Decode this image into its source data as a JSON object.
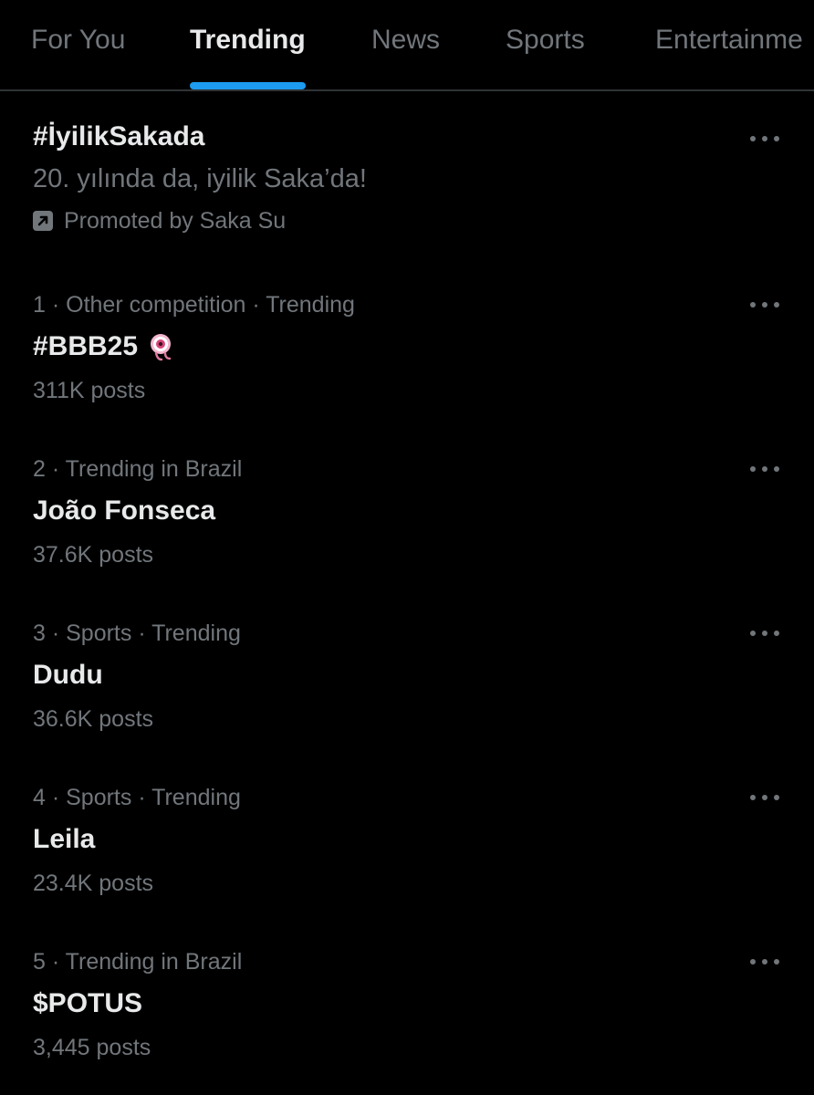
{
  "tabs": [
    {
      "label": "For You"
    },
    {
      "label": "Trending"
    },
    {
      "label": "News"
    },
    {
      "label": "Sports"
    },
    {
      "label": "Entertainme"
    }
  ],
  "colors": {
    "accent": "#1d9bf0",
    "background": "#000000",
    "primary_text": "#e7e9ea",
    "secondary_text": "#71767b"
  },
  "promoted": {
    "title": "#İyilikSakada",
    "subtitle": "20. yılında da, iyilik Saka’da!",
    "promoted_by": "Promoted by Saka Su",
    "icon": "promoted-arrow-icon"
  },
  "trends": [
    {
      "meta": "1 · Other competition · Trending",
      "name": "#BBB25",
      "count": "311K posts",
      "hashflag": "bbb-eye-icon"
    },
    {
      "meta": "2 · Trending in Brazil",
      "name": "João Fonseca",
      "count": "37.6K posts"
    },
    {
      "meta": "3 · Sports · Trending",
      "name": "Dudu",
      "count": "36.6K posts"
    },
    {
      "meta": "4 · Sports · Trending",
      "name": "Leila",
      "count": "23.4K posts"
    },
    {
      "meta": "5 · Trending in Brazil",
      "name": "$POTUS",
      "count": "3,445 posts"
    }
  ]
}
